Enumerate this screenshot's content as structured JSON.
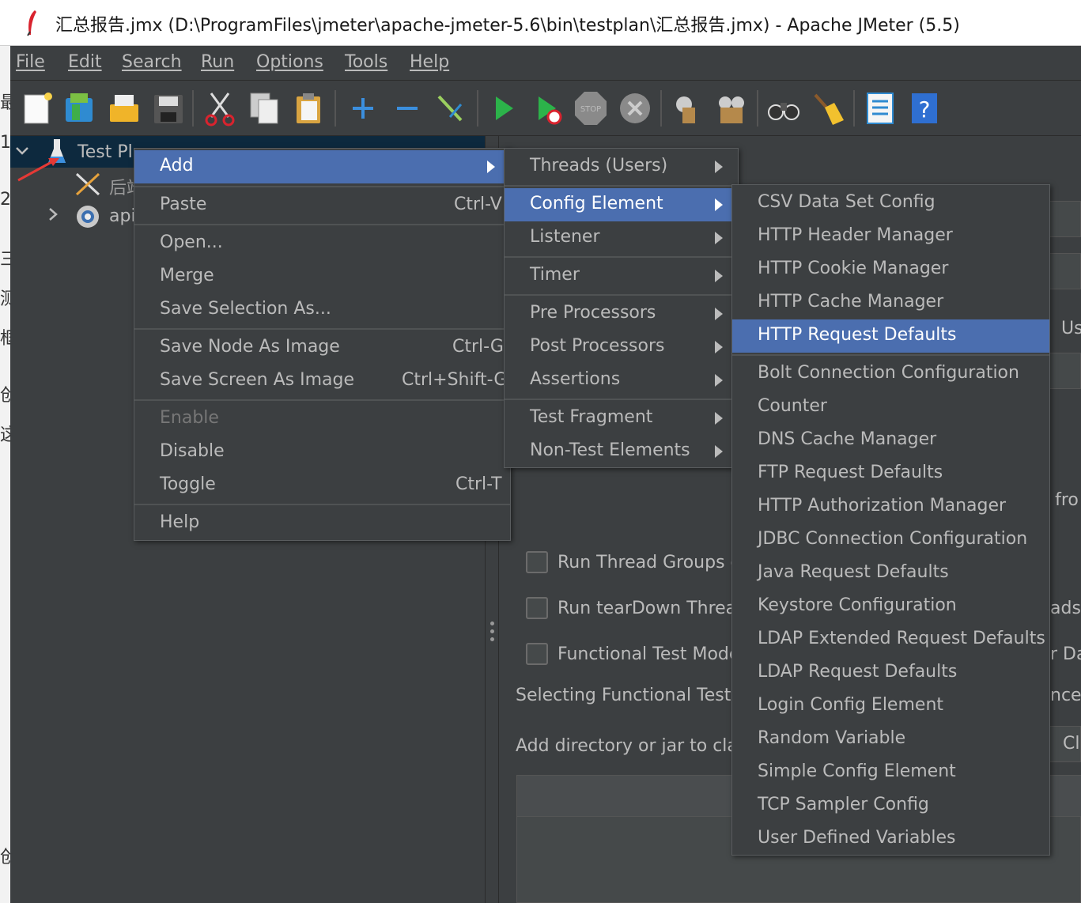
{
  "window": {
    "title": "汇总报告.jmx (D:\\ProgramFiles\\jmeter\\apache-jmeter-5.6\\bin\\testplan\\汇总报告.jmx) - Apache JMeter (5.5)"
  },
  "left_strip": {
    "chars": [
      "最",
      "1",
      "2",
      "三",
      "测",
      "框",
      "创",
      "这",
      "创"
    ]
  },
  "menubar": {
    "items": [
      "File",
      "Edit",
      "Search",
      "Run",
      "Options",
      "Tools",
      "Help"
    ]
  },
  "toolbar": {
    "icons": [
      "new-icon",
      "templates-icon",
      "open-icon",
      "save-icon",
      "cut-icon",
      "copy-icon",
      "paste-icon",
      "expand-icon",
      "collapse-icon",
      "toggle-icon",
      "start-icon",
      "start-no-pause-icon",
      "stop-icon",
      "shutdown-icon",
      "clear-icon",
      "clear-all-icon",
      "search-icon",
      "reset-search-icon",
      "function-helper-icon",
      "help-icon"
    ]
  },
  "tree": {
    "root": "Test Pl",
    "child1": "后端",
    "child2": "api"
  },
  "context_menu": {
    "items": [
      {
        "label": "Add",
        "shortcut": "",
        "submenu": true,
        "highlight": true
      },
      {
        "label": "Paste",
        "shortcut": "Ctrl-V"
      },
      {
        "label": "Open...",
        "shortcut": ""
      },
      {
        "label": "Merge",
        "shortcut": ""
      },
      {
        "label": "Save Selection As...",
        "shortcut": ""
      },
      {
        "label": "Save Node As Image",
        "shortcut": "Ctrl-G"
      },
      {
        "label": "Save Screen As Image",
        "shortcut": "Ctrl+Shift-G"
      },
      {
        "label": "Enable",
        "shortcut": "",
        "disabled": true
      },
      {
        "label": "Disable",
        "shortcut": ""
      },
      {
        "label": "Toggle",
        "shortcut": "Ctrl-T"
      },
      {
        "label": "Help",
        "shortcut": ""
      }
    ]
  },
  "add_submenu": {
    "items": [
      "Threads (Users)",
      "Config Element",
      "Listener",
      "Timer",
      "Pre Processors",
      "Post Processors",
      "Assertions",
      "Test Fragment",
      "Non-Test Elements"
    ],
    "highlighted": "Config Element"
  },
  "config_submenu": {
    "items": [
      "CSV Data Set Config",
      "HTTP Header Manager",
      "HTTP Cookie Manager",
      "HTTP Cache Manager",
      "HTTP Request Defaults",
      "Bolt Connection Configuration",
      "Counter",
      "DNS Cache Manager",
      "FTP Request Defaults",
      "HTTP Authorization Manager",
      "JDBC Connection Configuration",
      "Java Request Defaults",
      "Keystore Configuration",
      "LDAP Extended Request Defaults",
      "LDAP Request Defaults",
      "Login Config Element",
      "Random Variable",
      "Simple Config Element",
      "TCP Sampler Config",
      "User Defined Variables"
    ],
    "highlighted": "HTTP Request Defaults"
  },
  "right_panel": {
    "run_thread_groups": "Run Thread Groups c",
    "run_teardown": "Run tearDown Threa",
    "functional_mode": "Functional Test Mode",
    "selecting_text": "Selecting Functional Test",
    "add_directory": "Add directory or jar to cla",
    "edge_us": "Us",
    "edge_fro": "l fro",
    "edge_ads": "ads",
    "edge_rda": "r Da",
    "edge_nce": "nce.",
    "edge_cl": "Cl"
  },
  "colors": {
    "bg": "#3c3f41",
    "highlight": "#4b6eaf",
    "text": "#bbbbbb",
    "selection": "#0d293e"
  }
}
